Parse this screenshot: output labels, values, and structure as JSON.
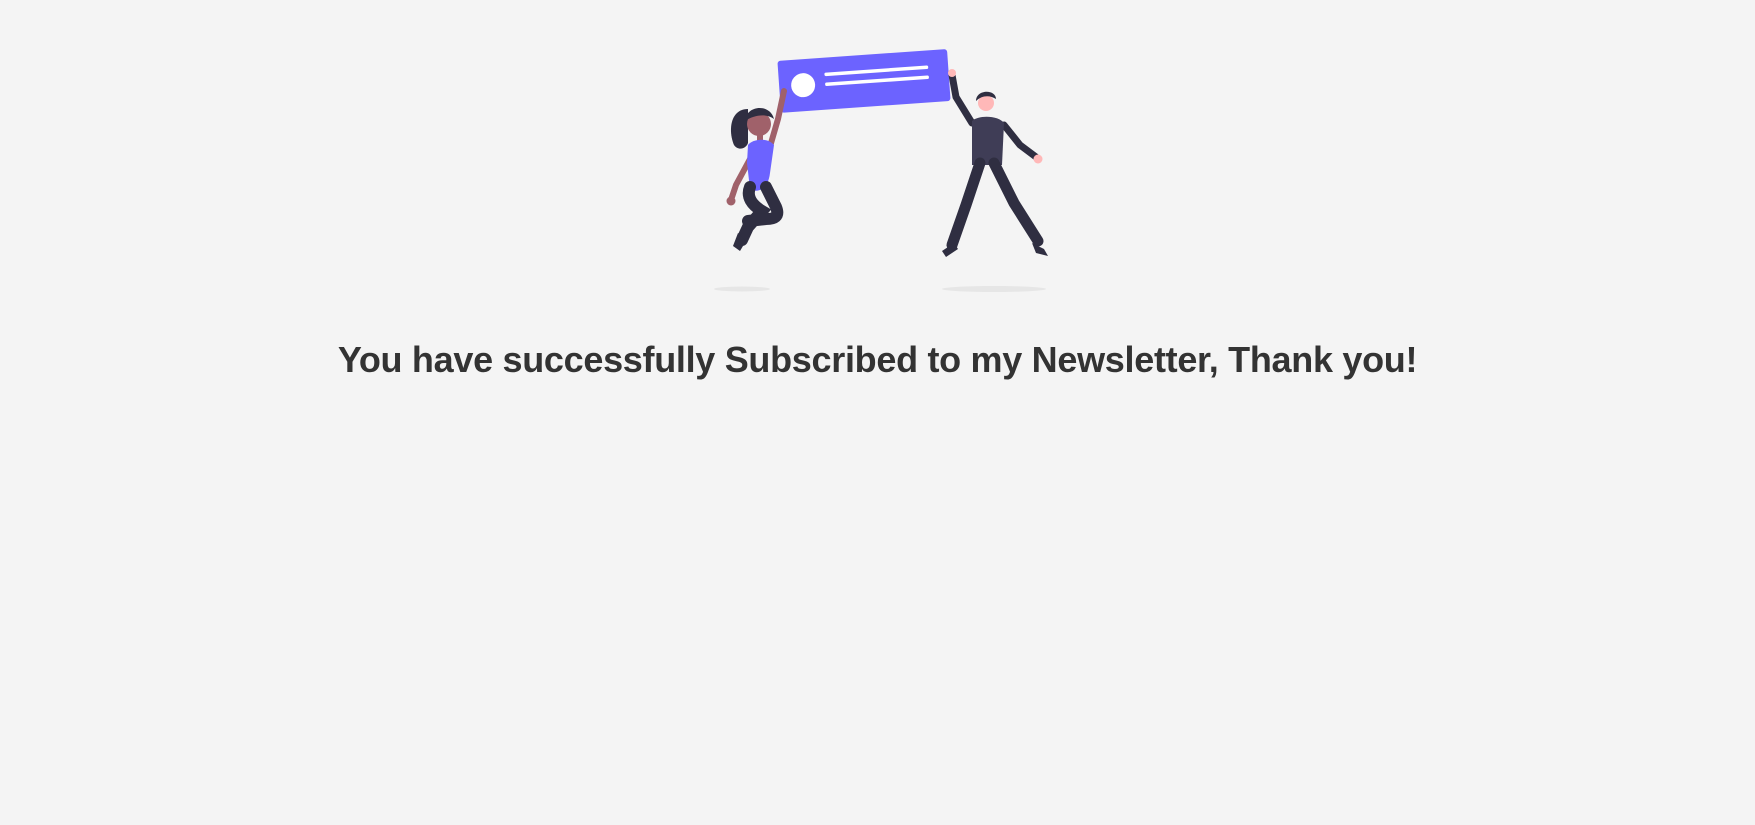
{
  "confirmation": {
    "message": "You have successfully Subscribed to my Newsletter, Thank you!"
  },
  "illustration": {
    "icon": "two-people-holding-newsletter-card-icon",
    "colors": {
      "accent": "#6c63ff",
      "dark": "#2f2e41",
      "skin_dark": "#a0616a",
      "skin_light": "#ffb8b8",
      "shadow": "#e6e6e6"
    }
  },
  "theme": {
    "background": "#f4f4f4",
    "text": "#333333"
  }
}
